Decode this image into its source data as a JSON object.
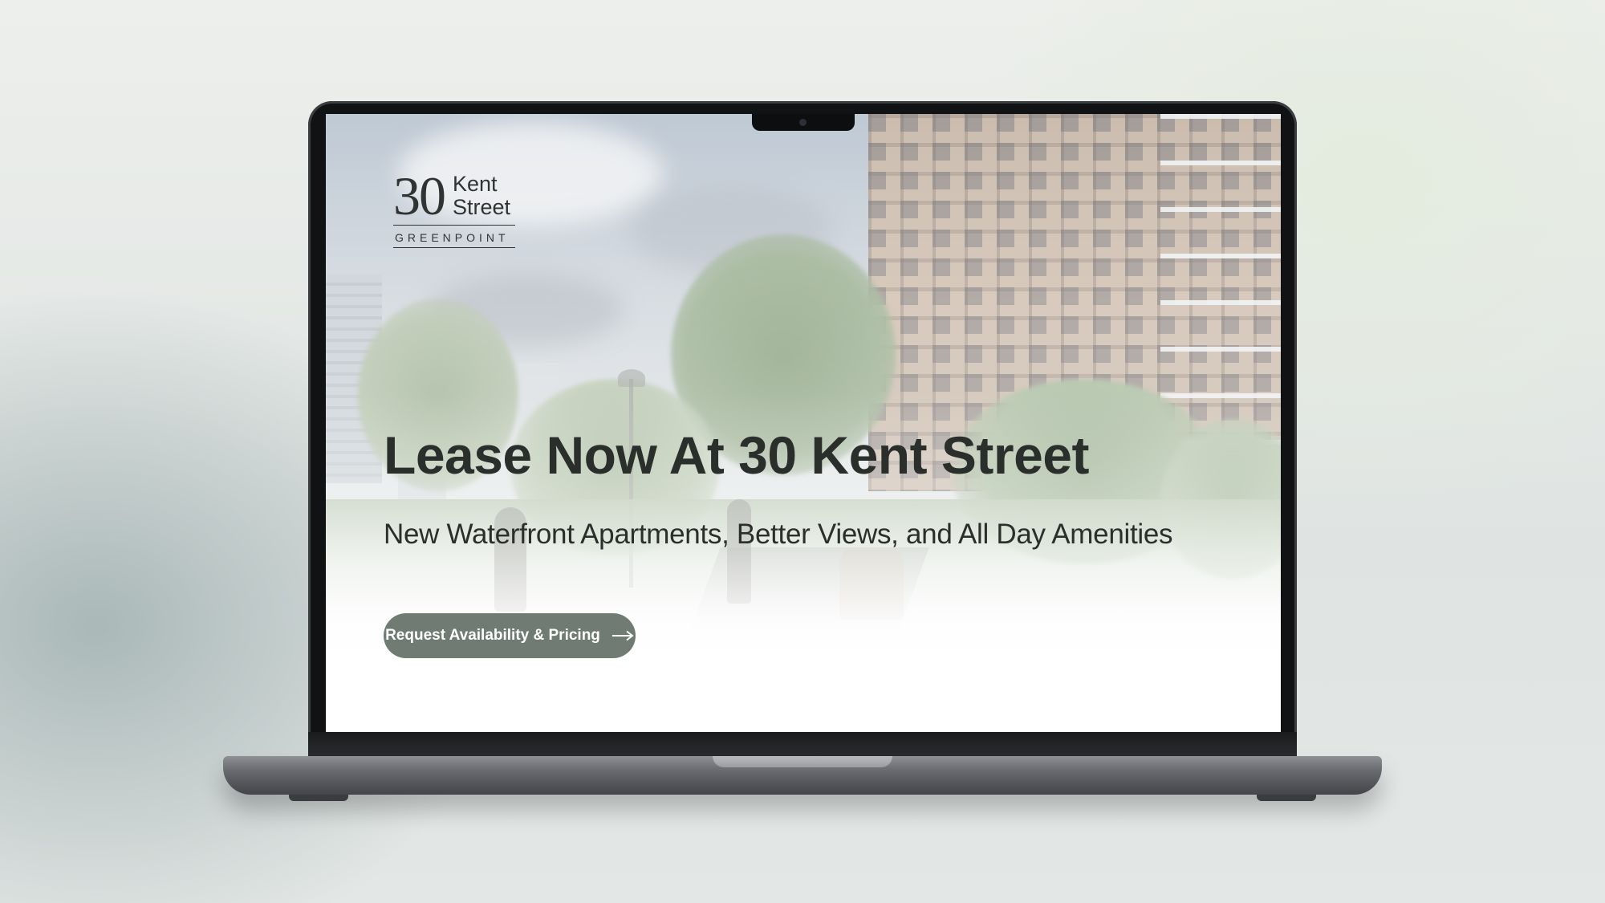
{
  "site": {
    "logo": {
      "number": "30",
      "name_line1": "Kent",
      "name_line2": "Street",
      "subtitle": "GREENPOINT"
    },
    "hero": {
      "headline": "Lease Now At 30 Kent Street",
      "subheadline": "New Waterfront Apartments, Better Views, and All Day Amenities",
      "cta_label": "Request Availability & Pricing",
      "cta_icon": "arrow-right-icon"
    }
  },
  "colors": {
    "cta_background": "#6f7b73",
    "text": "#2b2f2c",
    "laptop_frame": "#111213",
    "laptop_base": "#6b6c71"
  }
}
